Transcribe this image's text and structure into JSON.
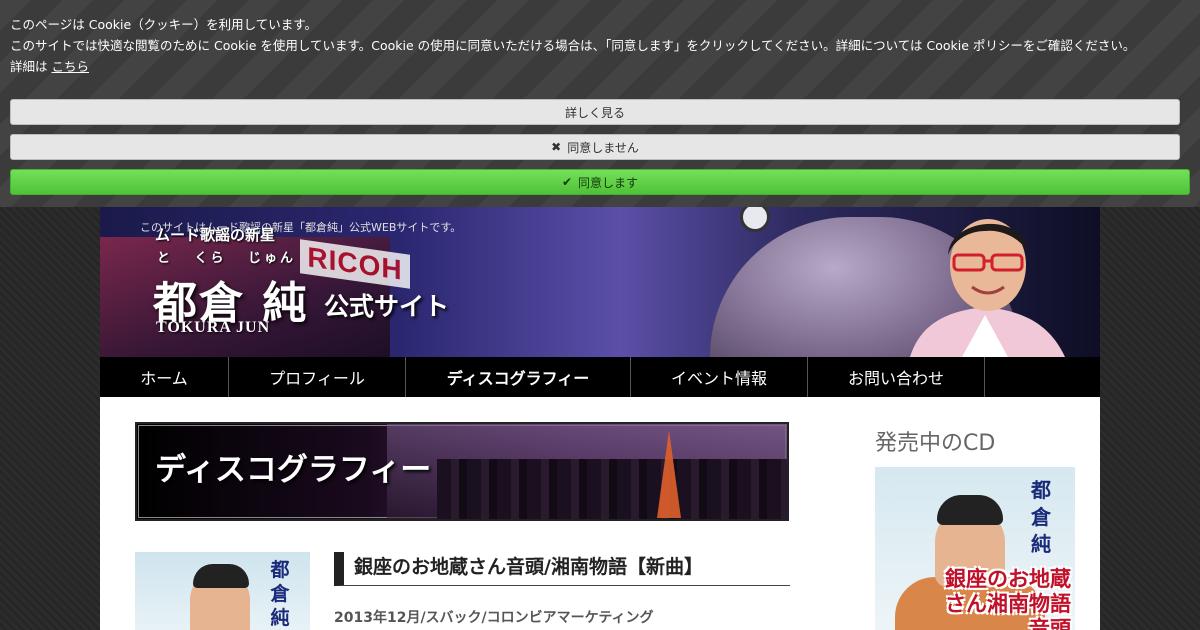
{
  "cookie_banner": {
    "line1": "このページは Cookie（クッキー）を利用しています。",
    "line2": "このサイトでは快適な閲覧のために Cookie を使用しています。Cookie の使用に同意いただける場合は、「同意します」をクリックしてください。詳細については Cookie ポリシーをご確認ください。",
    "detail_prefix": "詳細は",
    "detail_link": "こちら",
    "more_label": "詳しく見る",
    "decline_label": "同意しません",
    "accept_label": "同意します",
    "accept_color": "#5bd043"
  },
  "header": {
    "tagline": "このサイトはムード歌謡の新星「都倉純」公式WEBサイトです。",
    "catchphrase": "ムード歌謡の新星",
    "ruby": "と くら じゅん",
    "name": "都倉 純",
    "official": "公式サイト",
    "romaji": "TOKURA JUN",
    "sign_text": "RICOH"
  },
  "nav": {
    "items": [
      {
        "label": "ホーム"
      },
      {
        "label": "プロフィール"
      },
      {
        "label": "ディスコグラフィー"
      },
      {
        "label": "イベント情報"
      },
      {
        "label": "お問い合わせ"
      }
    ]
  },
  "main": {
    "page_title": "ディスコグラフィー",
    "song_title": "銀座のお地蔵さん音頭/湘南物語【新曲】",
    "song_meta": "2013年12月/スバック/コロンビアマーケティング",
    "thumb_name": "都倉純"
  },
  "sidebar": {
    "heading": "発売中のCD",
    "cd_name": "都倉純",
    "cd_title": "銀座のお地蔵さん湘南物語音頭"
  }
}
